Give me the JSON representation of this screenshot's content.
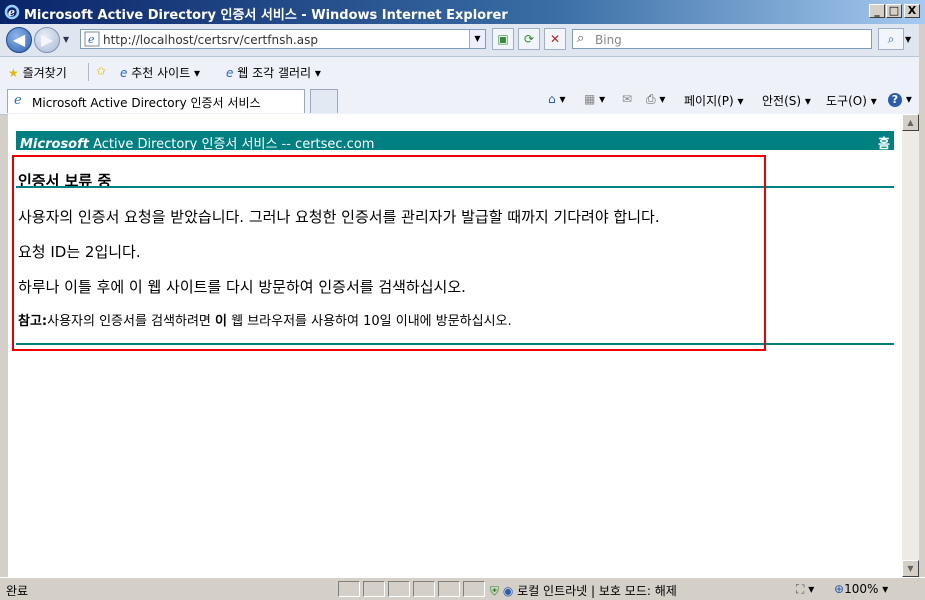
{
  "window": {
    "title": "Microsoft Active Directory 인증서 서비스 - Windows Internet Explorer",
    "minimize": "_",
    "maximize": "□",
    "close": "X"
  },
  "address": {
    "url": "http://localhost/certsrv/certfnsh.asp",
    "search_placeholder": "Bing"
  },
  "favorites": {
    "label": "즐겨찾기",
    "items": [
      {
        "label": "추천 사이트 ▾"
      },
      {
        "label": "웹 조각 갤러리 ▾"
      }
    ]
  },
  "tabs": {
    "active_label": "Microsoft Active Directory 인증서 서비스"
  },
  "commandbar": {
    "page": "페이지(P) ▾",
    "safety": "안전(S) ▾",
    "tools": "도구(O) ▾"
  },
  "page": {
    "brand_prefix": "Microsoft",
    "brand_rest": " Active Directory 인증서 서비스  --  certsec.com",
    "home": "홈",
    "title": "인증서 보류 중",
    "p1": "사용자의 인증서 요청을 받았습니다. 그러나 요청한 인증서를 관리자가 발급할 때까지 기다려야 합니다.",
    "p2": "요청 ID는 2입니다.",
    "p3": "하루나 이틀 후에 이 웹 사이트를 다시 방문하여 인증서를 검색하십시오.",
    "note_label": "참고:",
    "note_a": "사용자의 인증서를 검색하려면 ",
    "note_b": "이",
    "note_c": " 웹 브라우저를 사용하여 10일 이내에 방문하십시오."
  },
  "status": {
    "text": "완료",
    "zone": "로컬 인트라넷 | 보호 모드: 해제",
    "zoom": "100%"
  }
}
